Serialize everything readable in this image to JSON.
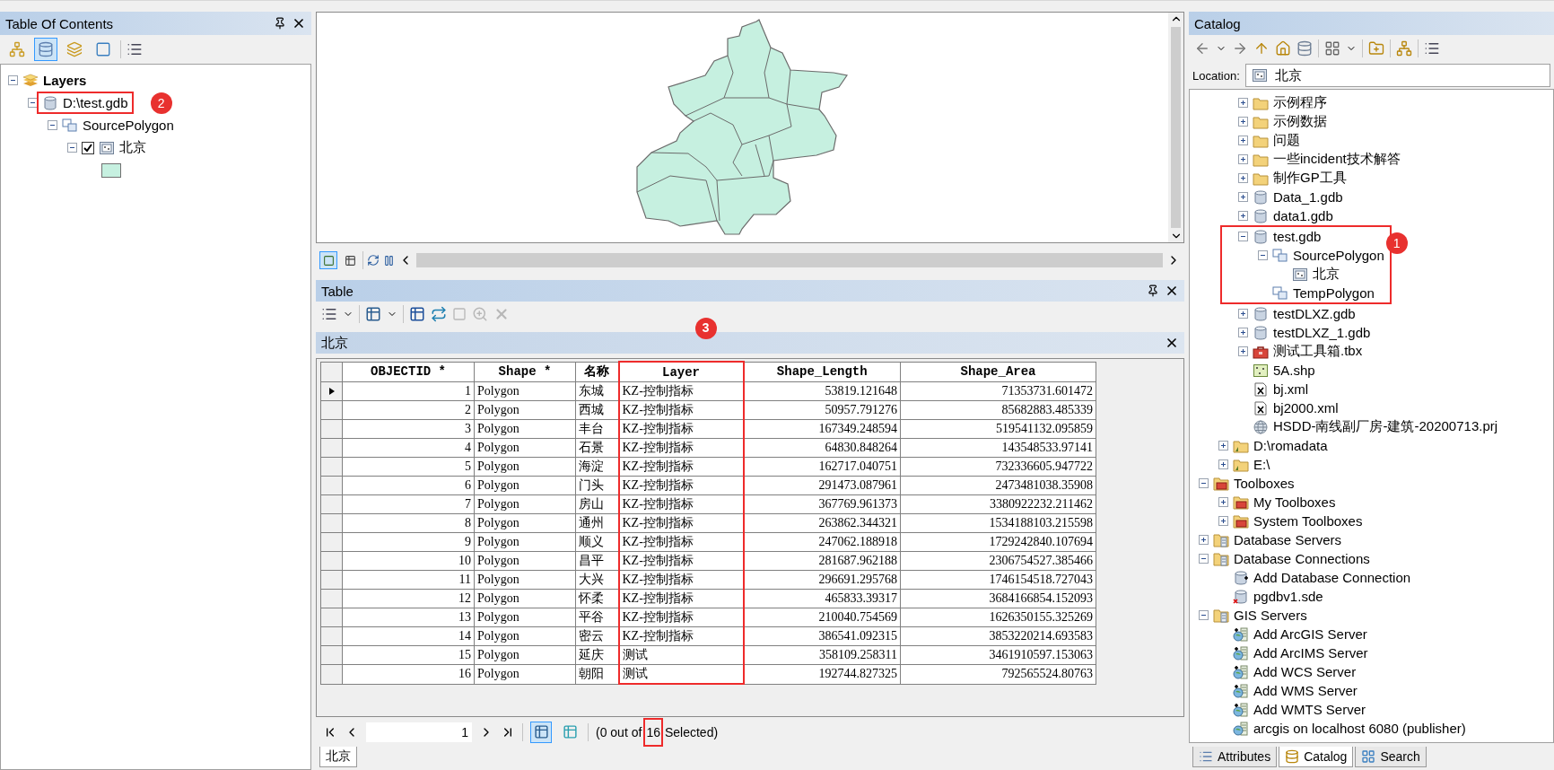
{
  "toc": {
    "title": "Table Of Contents",
    "view_modes": [
      {
        "selected": false
      },
      {
        "selected": true
      },
      {
        "selected": false
      },
      {
        "selected": false
      }
    ],
    "tree": [
      {
        "label": "Layers",
        "kind": "layers",
        "expanded": true,
        "children": [
          {
            "label": "D:\\test.gdb",
            "kind": "gdb",
            "expanded": true,
            "highlighted": true,
            "badge": "2",
            "children": [
              {
                "label": "SourcePolygon",
                "kind": "dataset",
                "expanded": true,
                "children": [
                  {
                    "label": "北京",
                    "kind": "layer",
                    "expanded": true,
                    "checked": true,
                    "children": [
                      {
                        "kind": "swatch",
                        "color": "#c6f0e0"
                      }
                    ]
                  }
                ]
              }
            ]
          }
        ]
      }
    ]
  },
  "map": {
    "views": [
      {
        "selected": true
      },
      {
        "selected": false
      }
    ]
  },
  "table": {
    "title": "Table",
    "tab": "北京",
    "columns": [
      {
        "label": "OBJECTID *",
        "numeric": true
      },
      {
        "label": "Shape *",
        "numeric": false
      },
      {
        "label": "名称",
        "numeric": false
      },
      {
        "label": "Layer",
        "numeric": false,
        "highlighted": true,
        "badge": "3"
      },
      {
        "label": "Shape_Length",
        "numeric": true
      },
      {
        "label": "Shape_Area",
        "numeric": true
      }
    ],
    "rows": [
      {
        "current": true,
        "cells": [
          "1",
          "Polygon",
          "东城",
          "KZ-控制指标",
          "53819.121648",
          "71353731.601472"
        ]
      },
      {
        "current": false,
        "cells": [
          "2",
          "Polygon",
          "西城",
          "KZ-控制指标",
          "50957.791276",
          "85682883.485339"
        ]
      },
      {
        "current": false,
        "cells": [
          "3",
          "Polygon",
          "丰台",
          "KZ-控制指标",
          "167349.248594",
          "519541132.095859"
        ]
      },
      {
        "current": false,
        "cells": [
          "4",
          "Polygon",
          "石景",
          "KZ-控制指标",
          "64830.848264",
          "143548533.97141"
        ]
      },
      {
        "current": false,
        "cells": [
          "5",
          "Polygon",
          "海淀",
          "KZ-控制指标",
          "162717.040751",
          "732336605.947722"
        ]
      },
      {
        "current": false,
        "cells": [
          "6",
          "Polygon",
          "门头",
          "KZ-控制指标",
          "291473.087961",
          "2473481038.35908"
        ]
      },
      {
        "current": false,
        "cells": [
          "7",
          "Polygon",
          "房山",
          "KZ-控制指标",
          "367769.961373",
          "3380922232.211462"
        ]
      },
      {
        "current": false,
        "cells": [
          "8",
          "Polygon",
          "通州",
          "KZ-控制指标",
          "263862.344321",
          "1534188103.215598"
        ]
      },
      {
        "current": false,
        "cells": [
          "9",
          "Polygon",
          "顺义",
          "KZ-控制指标",
          "247062.188918",
          "1729242840.107694"
        ]
      },
      {
        "current": false,
        "cells": [
          "10",
          "Polygon",
          "昌平",
          "KZ-控制指标",
          "281687.962188",
          "2306754527.385466"
        ]
      },
      {
        "current": false,
        "cells": [
          "11",
          "Polygon",
          "大兴",
          "KZ-控制指标",
          "296691.295768",
          "1746154518.727043"
        ]
      },
      {
        "current": false,
        "cells": [
          "12",
          "Polygon",
          "怀柔",
          "KZ-控制指标",
          "465833.39317",
          "3684166854.152093"
        ]
      },
      {
        "current": false,
        "cells": [
          "13",
          "Polygon",
          "平谷",
          "KZ-控制指标",
          "210040.754569",
          "1626350155.325269"
        ]
      },
      {
        "current": false,
        "cells": [
          "14",
          "Polygon",
          "密云",
          "KZ-控制指标",
          "386541.092315",
          "3853220214.693583"
        ]
      },
      {
        "current": false,
        "cells": [
          "15",
          "Polygon",
          "延庆",
          "测试",
          "358109.258311",
          "3461910597.153063"
        ]
      },
      {
        "current": false,
        "cells": [
          "16",
          "Polygon",
          "朝阳",
          "测试",
          "192744.827325",
          "792565524.80763"
        ]
      }
    ],
    "record": "1",
    "record_views": [
      {
        "selected": true
      },
      {
        "selected": false
      }
    ],
    "status": {
      "prefix": "(0 out of",
      "count": "16",
      "suffix": "Selected)",
      "highlighted": true
    },
    "layer_tabs": [
      {
        "label": "北京",
        "selected": true
      }
    ]
  },
  "catalog": {
    "title": "Catalog",
    "location": {
      "label": "Location:",
      "value": "北京"
    },
    "tree": [
      {
        "children": [
          {
            "children": [
              {
                "label": "示例程序",
                "kind": "folder",
                "expanded": false
              },
              {
                "label": "示例数据",
                "kind": "folder",
                "expanded": false
              },
              {
                "label": "问题",
                "kind": "folder",
                "expanded": false
              },
              {
                "label": "一些incident技术解答",
                "kind": "folder",
                "expanded": false
              },
              {
                "label": "制作GP工具",
                "kind": "folder",
                "expanded": false
              },
              {
                "label": "Data_1.gdb",
                "kind": "gdb",
                "expanded": false
              },
              {
                "label": "data1.gdb",
                "kind": "gdb",
                "expanded": false
              },
              {
                "label": "test.gdb",
                "kind": "gdb",
                "expanded": true,
                "highlighted": true,
                "badge": "1",
                "children": [
                  {
                    "label": "SourcePolygon",
                    "kind": "dataset",
                    "expanded": true,
                    "children": [
                      {
                        "label": "北京",
                        "kind": "fclass"
                      }
                    ]
                  },
                  {
                    "label": "TempPolygon",
                    "kind": "dataset"
                  }
                ]
              },
              {
                "label": "testDLXZ.gdb",
                "kind": "gdb",
                "expanded": false
              },
              {
                "label": "testDLXZ_1.gdb",
                "kind": "gdb",
                "expanded": false
              },
              {
                "label": "测试工具箱.tbx",
                "kind": "toolbox",
                "expanded": false
              },
              {
                "label": "5A.shp",
                "kind": "shp"
              },
              {
                "label": "bj.xml",
                "kind": "xml"
              },
              {
                "label": "bj2000.xml",
                "kind": "xml"
              },
              {
                "label": "HSDD-南线副厂房-建筑-20200713.prj",
                "kind": "prj"
              }
            ]
          },
          {
            "label": "D:\\romadata",
            "kind": "folderconn",
            "expanded": false
          },
          {
            "label": "E:\\",
            "kind": "folderconn",
            "expanded": false
          }
        ]
      },
      {
        "label": "Toolboxes",
        "kind": "toolboxes",
        "expanded": true,
        "children": [
          {
            "label": "My Toolboxes",
            "kind": "toolboxes",
            "expanded": false
          },
          {
            "label": "System Toolboxes",
            "kind": "toolboxes",
            "expanded": false
          }
        ]
      },
      {
        "label": "Database Servers",
        "kind": "servers",
        "expanded": false
      },
      {
        "label": "Database Connections",
        "kind": "servers",
        "expanded": true,
        "children": [
          {
            "label": "Add Database Connection",
            "kind": "adddb"
          },
          {
            "label": "pgdbv1.sde",
            "kind": "sde"
          }
        ]
      },
      {
        "label": "GIS Servers",
        "kind": "servers",
        "expanded": true,
        "children": [
          {
            "label": "Add ArcGIS Server",
            "kind": "addserver"
          },
          {
            "label": "Add ArcIMS Server",
            "kind": "addserver"
          },
          {
            "label": "Add WCS Server",
            "kind": "addserver"
          },
          {
            "label": "Add WMS Server",
            "kind": "addserver"
          },
          {
            "label": "Add WMTS Server",
            "kind": "addserver"
          },
          {
            "label": "arcgis on localhost 6080 (publisher)",
            "kind": "server"
          }
        ]
      }
    ],
    "tabs": [
      {
        "label": "Attributes",
        "selected": false
      },
      {
        "label": "Catalog",
        "selected": true
      },
      {
        "label": "Search",
        "selected": false
      }
    ]
  }
}
